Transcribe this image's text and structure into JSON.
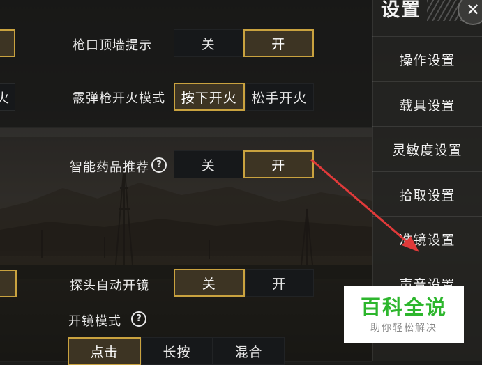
{
  "settings": {
    "muzzle_wall_hint": {
      "label": "枪口顶墙提示",
      "off": "关",
      "on": "开"
    },
    "shotgun_fire_mode": {
      "label": "霰弹枪开火模式",
      "press": "按下开火",
      "release": "松手开火"
    },
    "left_partial_fire": "火",
    "smart_medicine": {
      "label": "智能药品推荐",
      "help": "?",
      "off": "关",
      "on": "开"
    },
    "peek_auto_scope": {
      "label": "探头自动开镜",
      "off": "关",
      "on": "开"
    },
    "scope_mode": {
      "label": "开镜模式",
      "help": "?",
      "options": [
        "点击",
        "长按",
        "混合"
      ]
    }
  },
  "sidebar": {
    "title": "设置",
    "close": "✕",
    "items": [
      "操作设置",
      "载具设置",
      "灵敏度设置",
      "拾取设置",
      "准镜设置",
      "声音设置"
    ]
  },
  "watermark": {
    "main": "百科全说",
    "sub": "助你轻松解决"
  },
  "colors": {
    "accent_gold": "#c9a23f",
    "selected_bg": "#3d3423",
    "arrow": "#e03a3a",
    "watermark_green": "#2db62d"
  }
}
